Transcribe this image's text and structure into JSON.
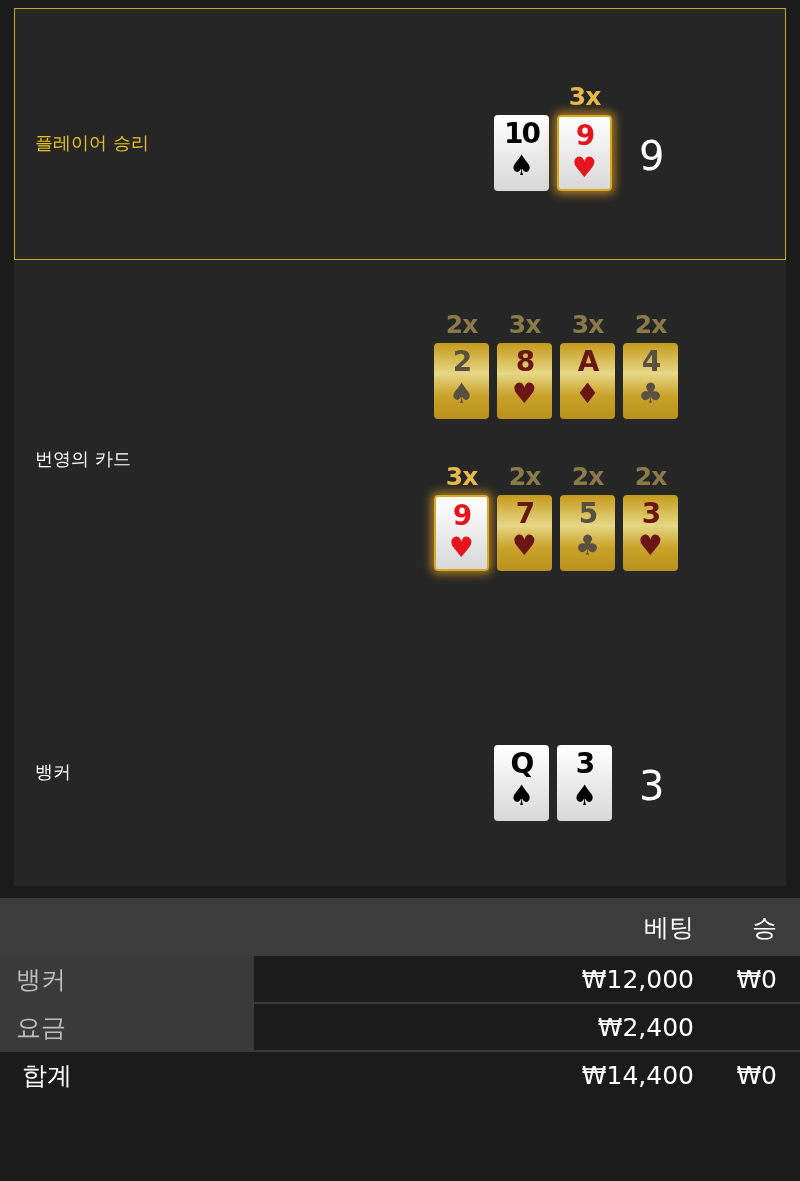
{
  "hands": [
    {
      "kind": "hand",
      "label": "플레이어 승리",
      "winner": true,
      "score": "9",
      "cards": [
        {
          "kind": "face",
          "rank": "10",
          "suit": "♠",
          "color": "#000000",
          "highlighted": false
        },
        {
          "kind": "face",
          "rank": "9",
          "suit": "♥",
          "color": "#e8141c",
          "highlighted": true,
          "multiplier": "3x"
        }
      ]
    },
    {
      "kind": "lucky",
      "label": "번영의 카드",
      "winner": false,
      "rows": [
        [
          {
            "kind": "gold",
            "rank": "2",
            "suit": "♠",
            "color": "#5a5042",
            "highlighted": false,
            "multiplier": "2x"
          },
          {
            "kind": "gold",
            "rank": "8",
            "suit": "♥",
            "color": "#6a1616",
            "highlighted": false,
            "multiplier": "3x"
          },
          {
            "kind": "gold",
            "rank": "A",
            "suit": "♦",
            "color": "#6a1616",
            "highlighted": false,
            "multiplier": "3x"
          },
          {
            "kind": "gold",
            "rank": "4",
            "suit": "♣",
            "color": "#5a5042",
            "highlighted": false,
            "multiplier": "2x"
          }
        ],
        [
          {
            "kind": "face",
            "rank": "9",
            "suit": "♥",
            "color": "#e8141c",
            "highlighted": true,
            "multiplier": "3x"
          },
          {
            "kind": "gold",
            "rank": "7",
            "suit": "♥",
            "color": "#6a1616",
            "highlighted": false,
            "multiplier": "2x"
          },
          {
            "kind": "gold",
            "rank": "5",
            "suit": "♣",
            "color": "#5a5042",
            "highlighted": false,
            "multiplier": "2x"
          },
          {
            "kind": "gold",
            "rank": "3",
            "suit": "♥",
            "color": "#6a1616",
            "highlighted": false,
            "multiplier": "2x"
          }
        ]
      ]
    },
    {
      "kind": "hand",
      "label": "뱅커",
      "winner": false,
      "score": "3",
      "cards": [
        {
          "kind": "face",
          "rank": "Q",
          "suit": "♠",
          "color": "#000000",
          "highlighted": false
        },
        {
          "kind": "face",
          "rank": "3",
          "suit": "♠",
          "color": "#000000",
          "highlighted": false
        }
      ]
    }
  ],
  "table": {
    "columns": [
      "베팅",
      "승"
    ],
    "rows": [
      {
        "kind": "bet",
        "label": "뱅커",
        "bet": "₩12,000",
        "win": "₩0"
      },
      {
        "kind": "bet",
        "label": "요금",
        "bet": "₩2,400"
      },
      {
        "kind": "total",
        "label": "합계",
        "bet": "₩14,400",
        "win": "₩0"
      }
    ]
  }
}
